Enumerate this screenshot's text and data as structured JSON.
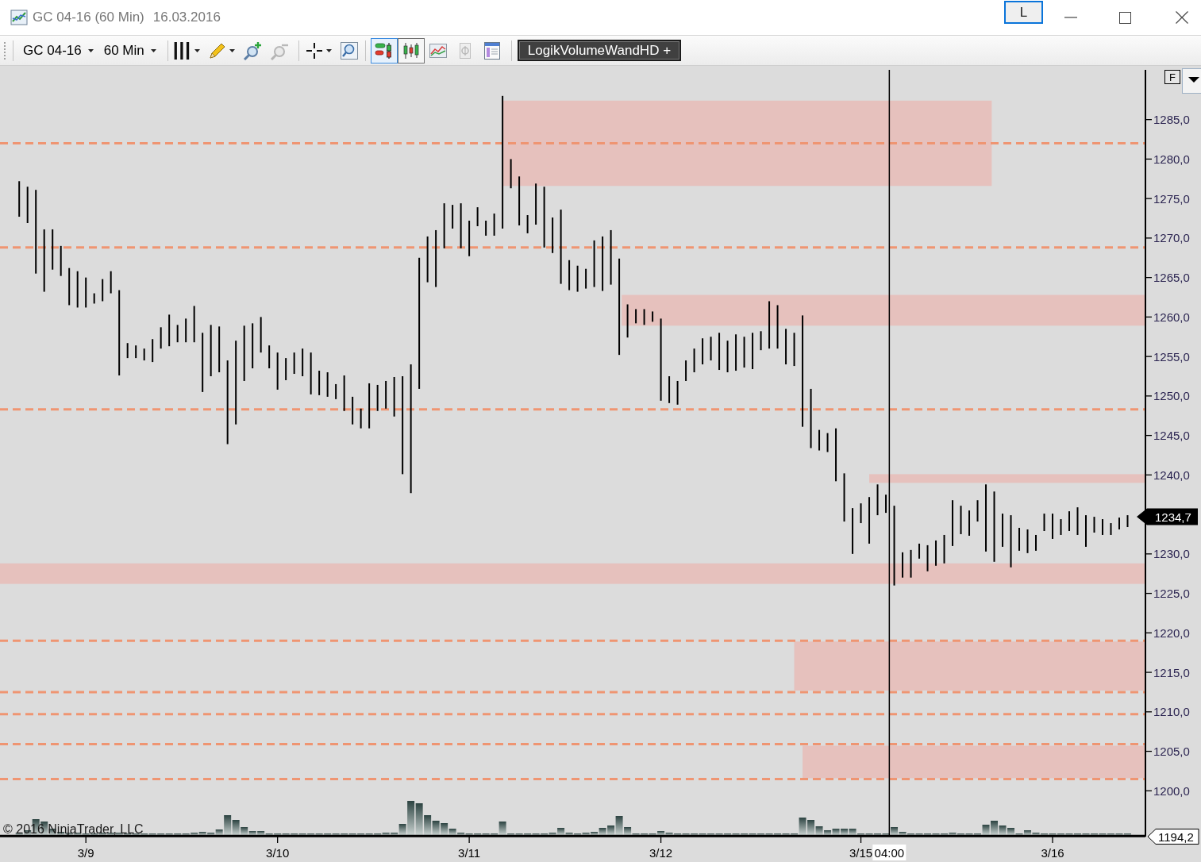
{
  "window": {
    "title": "GC 04-16 (60 Min)",
    "date": "16.03.2016",
    "layout_button": "L"
  },
  "toolbar": {
    "instrument": "GC 04-16",
    "interval": "60 Min",
    "tool_groups": [
      [
        {
          "kind": "bars",
          "menu": true,
          "selected": false,
          "focused": false,
          "disabled": false
        },
        {
          "kind": "pencil",
          "menu": true,
          "selected": false,
          "focused": false,
          "disabled": false
        },
        {
          "kind": "zoom-in",
          "menu": false,
          "selected": false,
          "focused": false,
          "disabled": false
        },
        {
          "kind": "zoom-out",
          "menu": false,
          "selected": false,
          "focused": false,
          "disabled": true
        }
      ],
      [
        {
          "kind": "crosshair",
          "menu": true,
          "selected": false,
          "focused": false,
          "disabled": false
        },
        {
          "kind": "magnifier",
          "menu": false,
          "selected": false,
          "focused": false,
          "disabled": false
        }
      ],
      [
        {
          "kind": "colored-bars",
          "menu": false,
          "selected": true,
          "focused": true,
          "disabled": false
        },
        {
          "kind": "candles",
          "menu": false,
          "selected": true,
          "focused": false,
          "disabled": false
        },
        {
          "kind": "line-chart",
          "menu": false,
          "selected": false,
          "focused": false,
          "disabled": false
        },
        {
          "kind": "dollar",
          "menu": false,
          "selected": false,
          "focused": false,
          "disabled": true
        },
        {
          "kind": "panel",
          "menu": false,
          "selected": false,
          "focused": false,
          "disabled": false
        }
      ]
    ],
    "indicator_button": "LogikVolumeWandHD +"
  },
  "chart": {
    "scale_button": "F",
    "copyright": "© 2016 NinjaTrader, LLC",
    "chart_data": [
      {
        "type": "bar",
        "categories": [
          null,
          null,
          null,
          null,
          null,
          null,
          null,
          null,
          "3/9",
          null,
          null,
          null,
          null,
          null,
          null,
          null,
          null,
          null,
          null,
          null,
          null,
          null,
          null,
          null,
          null,
          null,
          null,
          null,
          null,
          null,
          null,
          "3/10",
          null,
          null,
          null,
          null,
          null,
          null,
          null,
          null,
          null,
          null,
          null,
          null,
          null,
          null,
          null,
          null,
          null,
          null,
          null,
          null,
          null,
          null,
          "3/11",
          null,
          null,
          null,
          null,
          null,
          null,
          null,
          null,
          null,
          null,
          null,
          null,
          null,
          null,
          null,
          null,
          null,
          null,
          null,
          null,
          null,
          null,
          "3/12",
          null,
          null,
          null,
          null,
          null,
          null,
          null,
          null,
          null,
          null,
          null,
          null,
          null,
          null,
          null,
          null,
          null,
          null,
          null,
          null,
          null,
          null,
          null,
          "3/15",
          null,
          null,
          "04:00",
          null,
          null,
          null,
          null,
          null,
          null,
          null,
          null,
          null,
          null,
          null,
          null,
          null,
          null,
          null,
          null,
          null,
          null,
          null,
          "3/16",
          null,
          null,
          null,
          null,
          null,
          null,
          null,
          null,
          null
        ],
        "base": [
          1272.7,
          1271.9,
          1265.5,
          1263.2,
          1266.0,
          1265.2,
          1261.5,
          1261.2,
          1261.2,
          1261.7,
          1262.0,
          1263.0,
          1252.6,
          1254.8,
          1254.8,
          1254.5,
          1254.3,
          1256.0,
          1256.3,
          1256.8,
          1256.8,
          1256.8,
          1250.5,
          1252.5,
          1253.0,
          1243.9,
          1246.4,
          1251.9,
          1253.5,
          1255.5,
          1253.5,
          1250.8,
          1252.0,
          1252.8,
          1252.5,
          1250.2,
          1250.1,
          1249.9,
          1249.6,
          1248.1,
          1246.4,
          1245.9,
          1245.9,
          1248.1,
          1248.4,
          1247.4,
          1240.1,
          1237.7,
          1250.9,
          1264.4,
          1263.8,
          1268.7,
          1271.2,
          1268.7,
          1267.7,
          1271.5,
          1270.3,
          1270.3,
          1271.2,
          1276.3,
          1271.6,
          1270.6,
          1271.7,
          1268.8,
          1268.1,
          1264.2,
          1263.4,
          1263.2,
          1263.6,
          1263.8,
          1263.3,
          1264.1,
          1255.2,
          1257.4,
          1259.2,
          1259.0,
          1259.4,
          1249.4,
          1249.1,
          1248.9,
          1251.9,
          1253.0,
          1254.0,
          1254.5,
          1253.3,
          1253.0,
          1253.2,
          1253.6,
          1253.4,
          1255.8,
          1256.0,
          1256.0,
          1254.0,
          1253.8,
          1246.1,
          1243.4,
          1243.1,
          1242.9,
          1239.2,
          1234.1,
          1230.0,
          1233.9,
          1231.3,
          1234.9,
          1235.2,
          1226.0,
          1227.0,
          1227.0,
          1229.4,
          1227.8,
          1228.5,
          1228.8,
          1231.0,
          1232.5,
          1232.3,
          1234.1,
          1230.3,
          1229.0,
          1230.9,
          1228.3,
          1230.4,
          1230.1,
          1230.4,
          1232.9,
          1231.9,
          1232.4,
          1232.9,
          1232.4,
          1230.9,
          1232.7,
          1232.4,
          1232.4,
          1233.1,
          1233.4
        ],
        "values": [
          4.5,
          4.6,
          10.6,
          7.9,
          5.1,
          3.8,
          4.7,
          4.6,
          3.8,
          1.3,
          2.8,
          2.8,
          10.8,
          1.9,
          1.6,
          1.5,
          2.9,
          2.7,
          4.0,
          2.2,
          3.0,
          4.6,
          7.5,
          6.5,
          5.8,
          10.6,
          10.6,
          7.0,
          5.7,
          4.5,
          2.9,
          4.7,
          2.8,
          2.7,
          3.5,
          5.3,
          3.1,
          3.1,
          1.9,
          4.5,
          3.5,
          2.5,
          5.7,
          3.3,
          3.5,
          5.0,
          12.4,
          16.3,
          16.6,
          5.8,
          7.2,
          5.7,
          3.0,
          5.7,
          4.5,
          2.4,
          1.9,
          2.8,
          16.8,
          3.7,
          6.2,
          2.3,
          5.2,
          7.7,
          4.5,
          9.4,
          3.8,
          3.3,
          2.5,
          5.9,
          6.9,
          6.9,
          12.2,
          4.2,
          1.8,
          2.0,
          1.3,
          10.4,
          3.4,
          3.0,
          2.6,
          3.0,
          3.3,
          3.0,
          4.7,
          4.0,
          4.6,
          3.9,
          4.6,
          2.4,
          6.0,
          5.5,
          4.5,
          4.2,
          14.1,
          7.5,
          2.6,
          2.4,
          6.7,
          6.1,
          5.8,
          2.5,
          5.9,
          3.9,
          2.3,
          10.1,
          3.2,
          3.5,
          1.9,
          3.3,
          3.2,
          3.6,
          5.8,
          3.6,
          3.2,
          2.7,
          8.5,
          8.9,
          4.2,
          6.6,
          2.9,
          3.0,
          2.0,
          2.2,
          3.2,
          2.0,
          2.5,
          3.5,
          4.0,
          2.0,
          2.0,
          1.5,
          1.5,
          1.5
        ],
        "ylim": [
          1194.2,
          1291.4
        ],
        "yticks": [
          {
            "value": 1200,
            "label": "1200,0"
          },
          {
            "value": 1205,
            "label": "1205,0"
          },
          {
            "value": 1210,
            "label": "1210,0"
          },
          {
            "value": 1215,
            "label": "1215,0"
          },
          {
            "value": 1220,
            "label": "1220,0"
          },
          {
            "value": 1225,
            "label": "1225,0"
          },
          {
            "value": 1230,
            "label": "1230,0"
          },
          {
            "value": 1240,
            "label": "1240,0"
          },
          {
            "value": 1245,
            "label": "1245,0"
          },
          {
            "value": 1250,
            "label": "1250,0"
          },
          {
            "value": 1255,
            "label": "1255,0"
          },
          {
            "value": 1260,
            "label": "1260,0"
          },
          {
            "value": 1265,
            "label": "1265,0"
          },
          {
            "value": 1270,
            "label": "1270,0"
          },
          {
            "value": 1275,
            "label": "1275,0"
          },
          {
            "value": 1280,
            "label": "1280,0"
          },
          {
            "value": 1285,
            "label": "1285,0"
          }
        ],
        "bands": [
          {
            "axis": "y",
            "from": 1276.6,
            "to": 1287.4
          },
          {
            "axis": "y",
            "from": 1258.9,
            "to": 1262.8
          },
          {
            "axis": "y",
            "from": 1239.0,
            "to": 1240.1
          },
          {
            "axis": "y",
            "from": 1226.2,
            "to": 1228.8
          },
          {
            "axis": "y",
            "from": 1212.7,
            "to": 1218.9
          },
          {
            "axis": "y",
            "from": 1201.6,
            "to": 1205.7
          }
        ],
        "ref_lines": [
          {
            "axis": "y",
            "value": 1282.0,
            "line_style": "dashed"
          },
          {
            "axis": "y",
            "value": 1268.8,
            "line_style": "dashed"
          },
          {
            "axis": "y",
            "value": 1248.3,
            "line_style": "dashed"
          },
          {
            "axis": "y",
            "value": 1219.0,
            "line_style": "dashed"
          },
          {
            "axis": "y",
            "value": 1212.5,
            "line_style": "dashed"
          },
          {
            "axis": "y",
            "value": 1209.7,
            "line_style": "dashed"
          },
          {
            "axis": "y",
            "value": 1205.9,
            "line_style": "dashed"
          },
          {
            "axis": "y",
            "value": 1201.5,
            "line_style": "dashed"
          },
          {
            "axis": "x",
            "value": "04:00",
            "line_style": "solid"
          },
          {
            "axis": "y",
            "value": 1194.2,
            "label": "1194,2",
            "line_style": "solid"
          }
        ],
        "annotations": [
          "1234,7"
        ]
      }
    ]
  }
}
